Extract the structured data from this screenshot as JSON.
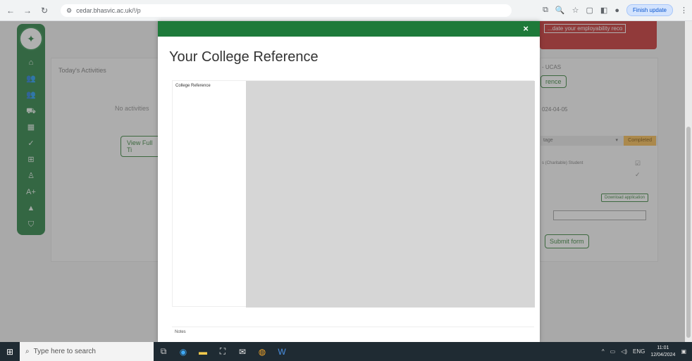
{
  "browser": {
    "url": "cedar.bhasvic.ac.uk/!/p",
    "finish_update_label": "Finish update",
    "icons": {
      "back": "back-arrow-icon",
      "forward": "forward-arrow-icon",
      "reload": "reload-icon",
      "site_info": "site-info-icon"
    }
  },
  "background_page": {
    "todays_activities_title": "Today's Activities",
    "no_activities_text": "No activities",
    "view_full_button": "View Full Ti",
    "banner_text": "...date your employability reco",
    "ucas_heading": "- UCAS",
    "reference_button": "rence",
    "date_text": "024-04-05",
    "stage_label": "tage",
    "completed_label": "Completed",
    "charitable_text": "s (Charitable) Student",
    "download_button": "Download application",
    "submit_button": "Submit form"
  },
  "modal": {
    "title": "Your College Reference",
    "reference_label": "College Reference",
    "notes_label": "Notes",
    "colors": {
      "header_bar": "#1e7a3a",
      "preview_area": "#d6d6d6"
    }
  },
  "taskbar": {
    "search_placeholder": "Type here to search",
    "time": "11:01",
    "date": "12/04/2024",
    "language": "ENG"
  },
  "colors": {
    "brand_green": "#1e7a3a",
    "alert_red": "#c62828",
    "status_amber": "#f6b94a"
  }
}
